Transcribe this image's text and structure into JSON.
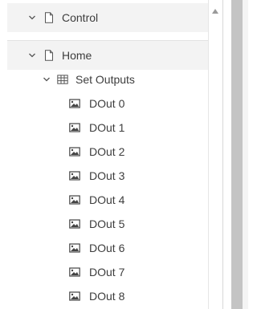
{
  "tree": {
    "groups": [
      {
        "label": "Control",
        "icon": "document-icon",
        "expanded": true
      },
      {
        "label": "Home",
        "icon": "document-icon",
        "expanded": true
      }
    ],
    "folder": {
      "label": "Set Outputs",
      "icon": "table-icon",
      "expanded": true
    },
    "items": [
      {
        "label": "DOut 0",
        "icon": "image-icon"
      },
      {
        "label": "DOut 1",
        "icon": "image-icon"
      },
      {
        "label": "DOut 2",
        "icon": "image-icon"
      },
      {
        "label": "DOut 3",
        "icon": "image-icon"
      },
      {
        "label": "DOut 4",
        "icon": "image-icon"
      },
      {
        "label": "DOut 5",
        "icon": "image-icon"
      },
      {
        "label": "DOut 6",
        "icon": "image-icon"
      },
      {
        "label": "DOut 7",
        "icon": "image-icon"
      },
      {
        "label": "DOut 8",
        "icon": "image-icon"
      }
    ]
  },
  "colors": {
    "group_bg": "#f3f3f3",
    "text": "#3d3d3d",
    "splitter": "#c4c4c4"
  }
}
